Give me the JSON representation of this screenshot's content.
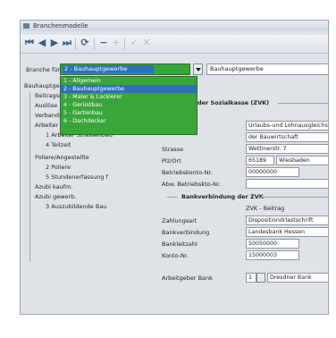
{
  "window": {
    "title": "Branchenmodelle"
  },
  "toolbar": {
    "buttons": {
      "first": "⏮",
      "prev": "◀",
      "next": "▶",
      "last": "⏭",
      "refresh": "⟳",
      "remove": "−",
      "add": "+",
      "confirm": "✓",
      "cancel": "✕"
    }
  },
  "branch": {
    "label": "Branche für:",
    "selected": "2 - Bauhauptgewerbe",
    "field": "Bauhauptgewerbe",
    "options": [
      "1 - Allgemein",
      "2 - Bauhauptgewerbe",
      "3 - Maler & Lackierer",
      "4 - Gerüstbau",
      "5 - Gartenbau",
      "6 - Dachdecker"
    ],
    "selected_index": 1
  },
  "tree": [
    {
      "label": "Bauhauptgewerbe",
      "indent": 0
    },
    {
      "label": "Beitragsgruppe",
      "indent": 1
    },
    {
      "label": "Auslöse",
      "indent": 1
    },
    {
      "label": "Verbandsbeitrag",
      "indent": 1
    },
    {
      "label": "Arbeiter",
      "indent": 1
    },
    {
      "label": "1 Arbeiter Strassenbau",
      "indent": 2
    },
    {
      "label": "4 Teilzeit",
      "indent": 2
    },
    {
      "label": "Poliere/Angestellte",
      "indent": 1
    },
    {
      "label": "2 Poliere",
      "indent": 2
    },
    {
      "label": "5 Stundenerfassung f",
      "indent": 2
    },
    {
      "label": "Azubi kaufm.",
      "indent": 1
    },
    {
      "label": "Azubi gewerb.",
      "indent": 1
    },
    {
      "label": "3 Auszubildende Bau",
      "indent": 2
    }
  ],
  "soka": {
    "title": "der Sozialkasse (ZVK)",
    "inputs": [
      "Urlaubs-und Lohnausgleichskasse",
      "der Bauwirtschaft",
      "Wettinerstr. 7"
    ],
    "strasse_label": "Strasse",
    "plzort_label": "Plz/Ort",
    "plz": "65189",
    "ort": "Wiesbaden",
    "betriebskonto_label": "Betriebskonto-Nr.",
    "betriebskonto": "00000000",
    "abw_label": "Abw. Betriebskto-Nr.",
    "abw": ""
  },
  "bank": {
    "title": "Bankverbindung der ZVK",
    "subtitle": "ZVK - Beitrag",
    "zahlungsart_label": "Zahlungsart",
    "zahlungsart": "Dispositiondrlastschrift",
    "bankverbindung_label": "Bankverbindung",
    "bankverbindung": "Landesbank Hessen",
    "bankleitzahl_label": "Bankleitzahl",
    "bankleitzahl": "50050000",
    "konto_label": "Konto-Nr.",
    "konto": "15000003",
    "arbeitgeber_label": "Arbeitgeber Bank",
    "arbeitgeber_num": "1",
    "arbeitgeber_bank": "Dresdner Bank"
  }
}
